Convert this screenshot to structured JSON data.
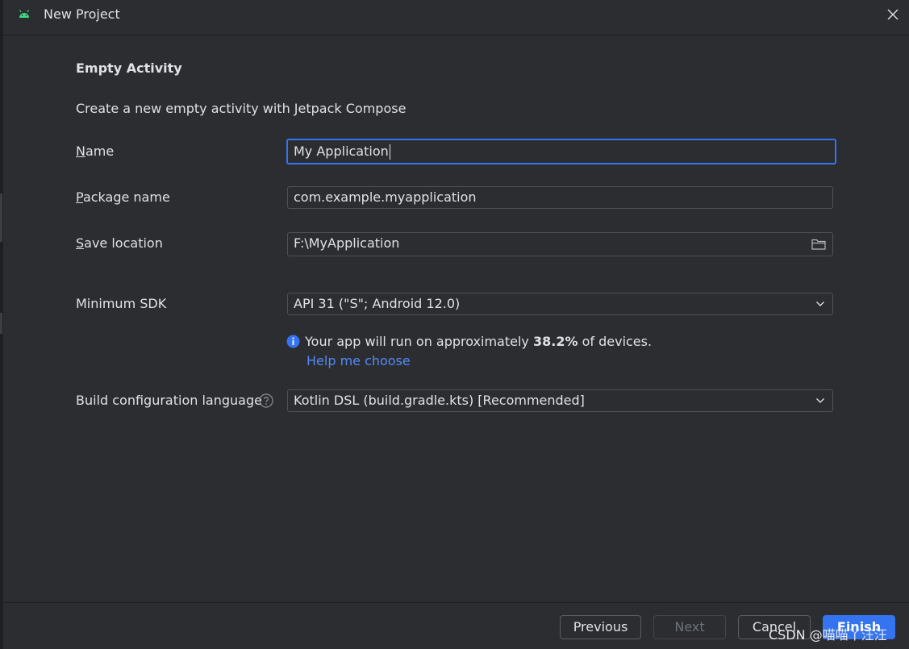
{
  "window": {
    "title": "New Project",
    "icons": {
      "app": "android-icon",
      "close": "close-icon"
    }
  },
  "form": {
    "heading": "Empty Activity",
    "description": "Create a new empty activity with Jetpack Compose",
    "name": {
      "label_mnemonic": "N",
      "label_rest": "ame",
      "value": "My Application"
    },
    "package_name": {
      "label_mnemonic": "P",
      "label_rest": "ackage name",
      "value": "com.example.myapplication"
    },
    "save_location": {
      "label_mnemonic": "S",
      "label_rest": "ave location",
      "value": "F:\\MyApplication",
      "icon": "folder-icon"
    },
    "minimum_sdk": {
      "label": "Minimum SDK",
      "value": "API 31 (\"S\"; Android 12.0)",
      "icon": "chevron-down-icon"
    },
    "sdk_info": {
      "text_before": "Your app will run on approximately ",
      "percentage": "38.2%",
      "text_after": " of devices.",
      "link": "Help me choose",
      "icon": "info-icon"
    },
    "build_config": {
      "label": "Build configuration language",
      "value": "Kotlin DSL (build.gradle.kts) [Recommended]",
      "help_icon": "question-icon",
      "icon": "chevron-down-icon"
    }
  },
  "footer": {
    "previous": "Previous",
    "next": "Next",
    "cancel": "Cancel",
    "finish": "Finish"
  },
  "watermark": "CSDN @喵喵丫汪汪",
  "colors": {
    "background": "#2b2d30",
    "accent": "#3574f0",
    "link": "#548af7",
    "android": "#3ddc84"
  }
}
